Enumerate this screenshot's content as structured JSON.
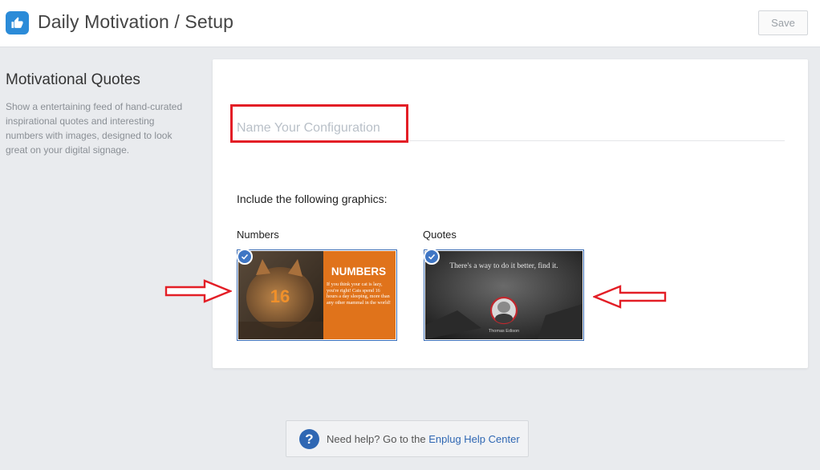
{
  "header": {
    "title": "Daily Motivation / Setup",
    "save_label": "Save"
  },
  "sidebar": {
    "title": "Motivational Quotes",
    "description": "Show a entertaining feed of hand-curated inspirational quotes and interesting numbers with images, designed to look great on your digital signage."
  },
  "config": {
    "name_placeholder": "Name Your Configuration",
    "name_value": ""
  },
  "graphics": {
    "include_label": "Include the following graphics:",
    "items": [
      {
        "label": "Numbers",
        "selected": true,
        "preview": {
          "big_number": "16",
          "heading": "NUMBERS",
          "body": "If you think your cat is lazy, you're right! Cats spend 16 hours a day sleeping, more than any other mammal in the world!"
        }
      },
      {
        "label": "Quotes",
        "selected": true,
        "preview": {
          "quote": "There's a way to do it better, find it.",
          "author": "Thomas Edison"
        }
      }
    ]
  },
  "help": {
    "text": "Need help? Go to the ",
    "link": "Enplug Help Center"
  },
  "colors": {
    "accent": "#2f67b3",
    "annotation_red": "#e31e26",
    "numbers_orange": "#e0731b"
  }
}
